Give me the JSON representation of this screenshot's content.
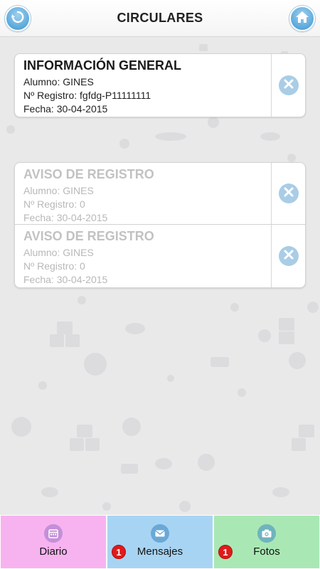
{
  "header": {
    "title": "CIRCULARES",
    "back_icon": "back-arrow-icon",
    "home_icon": "home-icon"
  },
  "circulars": [
    {
      "title": "INFORMACIÓN GENERAL",
      "alumno": "Alumno: GINES",
      "registro": "Nº Registro: fgfdg-P11111111",
      "fecha": "Fecha: 30-04-2015",
      "read": false
    },
    {
      "title": "AVISO DE REGISTRO",
      "alumno": "Alumno: GINES",
      "registro": "Nº Registro: 0",
      "fecha": "Fecha: 30-04-2015",
      "read": true
    },
    {
      "title": "AVISO DE REGISTRO",
      "alumno": "Alumno: GINES",
      "registro": "Nº Registro: 0",
      "fecha": "Fecha: 30-04-2015",
      "read": true
    }
  ],
  "tabs": [
    {
      "label": "Diario",
      "icon": "calendar-icon",
      "color": "#f7b3ef",
      "badge": null
    },
    {
      "label": "Mensajes",
      "icon": "envelope-icon",
      "color": "#a8d4f3",
      "badge": "1"
    },
    {
      "label": "Fotos",
      "icon": "camera-icon",
      "color": "#a9e8b4",
      "badge": "1"
    }
  ],
  "colors": {
    "accent": "#5aa8db",
    "delete": "#a9cde6",
    "badge": "#e01b1b"
  }
}
